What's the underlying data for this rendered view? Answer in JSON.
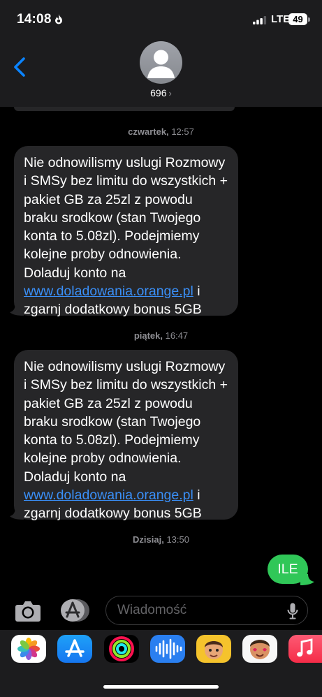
{
  "status_bar": {
    "time": "14:08",
    "network": "LTE",
    "battery": "49"
  },
  "header": {
    "contact_name": "696",
    "chevron": "›"
  },
  "messages": [
    {
      "timestamp_day": "czwartek,",
      "timestamp_time": "12:57",
      "text_before_link": "Nie odnowilismy uslugi Rozmowy i SMSy bez limitu do wszystkich + pakiet GB za 25zl z powodu braku srodkow (stan Twojego konta to 5.08zl). Podejmiemy kolejne proby odnowienia. Doladuj konto na ",
      "link": "www.doladowania.orange.pl",
      "text_after_link": " i zgarnj dodatkowy bonus 5GB"
    },
    {
      "timestamp_day": "piątek,",
      "timestamp_time": "16:47",
      "text_before_link": "Nie odnowilismy uslugi Rozmowy i SMSy bez limitu do wszystkich + pakiet GB za 25zl z powodu braku srodkow (stan Twojego konta to 5.08zl). Podejmiemy kolejne proby odnowienia. Doladuj konto na ",
      "link": "www.doladowania.orange.pl",
      "text_after_link": " i zgarnj dodatkowy bonus 5GB"
    }
  ],
  "sent": {
    "timestamp_day": "Dzisiaj,",
    "timestamp_time": "13:50",
    "text": "ILE"
  },
  "composer": {
    "placeholder": "Wiadomość"
  },
  "icons": {
    "back": "chevron-left-icon",
    "camera": "camera-icon",
    "apps": "app-store-icon",
    "mic": "microphone-icon"
  },
  "app_drawer": [
    "photos",
    "app-store",
    "fitness",
    "audio-message",
    "memoji",
    "memoji-stickers",
    "music"
  ],
  "colors": {
    "received_bubble": "#262628",
    "sent_bubble": "#30c758",
    "link": "#3a8ff7",
    "background": "#000000",
    "header": "#1c1c1e"
  }
}
